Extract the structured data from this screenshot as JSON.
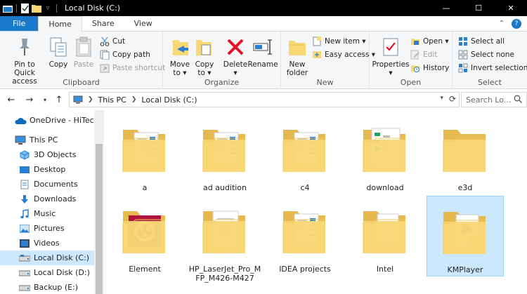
{
  "window": {
    "title": "Local Disk (C:)",
    "controls": {
      "minimize": "—",
      "maximize": "☐",
      "close": "✕"
    }
  },
  "ribbon_tabs": [
    "File",
    "Home",
    "Share",
    "View"
  ],
  "ribbon": {
    "clipboard": {
      "label": "Clipboard",
      "pin": "Pin to Quick\naccess",
      "copy": "Copy",
      "paste": "Paste",
      "cut": "Cut",
      "copy_path": "Copy path",
      "paste_shortcut": "Paste shortcut"
    },
    "organize": {
      "label": "Organize",
      "move_to": "Move\nto ▾",
      "copy_to": "Copy\nto ▾",
      "delete": "Delete\n▾",
      "rename": "Rename"
    },
    "new": {
      "label": "New",
      "new_folder": "New\nfolder",
      "new_item": "New item ▾",
      "easy_access": "Easy access ▾"
    },
    "open": {
      "label": "Open",
      "properties": "Properties\n▾",
      "open": "Open ▾",
      "edit": "Edit",
      "history": "History"
    },
    "select": {
      "label": "Select",
      "select_all": "Select all",
      "select_none": "Select none",
      "invert_selection": "Invert selection"
    }
  },
  "address": {
    "crumbs": [
      "This PC",
      "Local Disk (C:)"
    ],
    "search_placeholder": "Search Lo..."
  },
  "nav_pane": {
    "items": [
      {
        "label": "OneDrive - HiTech R",
        "icon": "cloud-icon"
      },
      {
        "label": "This PC",
        "icon": "computer-icon"
      },
      {
        "label": "3D Objects",
        "icon": "cube-icon"
      },
      {
        "label": "Desktop",
        "icon": "desktop-icon"
      },
      {
        "label": "Documents",
        "icon": "documents-icon"
      },
      {
        "label": "Downloads",
        "icon": "download-icon"
      },
      {
        "label": "Music",
        "icon": "music-icon"
      },
      {
        "label": "Pictures",
        "icon": "pictures-icon"
      },
      {
        "label": "Videos",
        "icon": "videos-icon"
      },
      {
        "label": "Local Disk (C:)",
        "icon": "drive-icon"
      },
      {
        "label": "Local Disk (D:)",
        "icon": "drive-icon"
      },
      {
        "label": "Backup (E:)",
        "icon": "drive-icon"
      }
    ],
    "selected": "Local Disk (C:)"
  },
  "folders": [
    {
      "name": "a",
      "thumb": "doc"
    },
    {
      "name": "ad audition",
      "thumb": "doc"
    },
    {
      "name": "c4",
      "thumb": "doc"
    },
    {
      "name": "download",
      "thumb": "sheet"
    },
    {
      "name": "e3d",
      "thumb": "plain"
    },
    {
      "name": "Element",
      "thumb": "element"
    },
    {
      "name": "HP_LaserJet_Pro_MFP_M426-M427",
      "thumb": "paper"
    },
    {
      "name": "IDEA projects",
      "thumb": "doc"
    },
    {
      "name": "Intel",
      "thumb": "plain-doc"
    },
    {
      "name": "KMPlayer",
      "thumb": "kmplayer",
      "selected": true
    }
  ],
  "colors": {
    "titlebar": "#000000",
    "file_tab": "#1979ca",
    "ribbon_bg": "#f5f6f7",
    "selection": "#cce8ff",
    "folder": "#f8d775"
  }
}
